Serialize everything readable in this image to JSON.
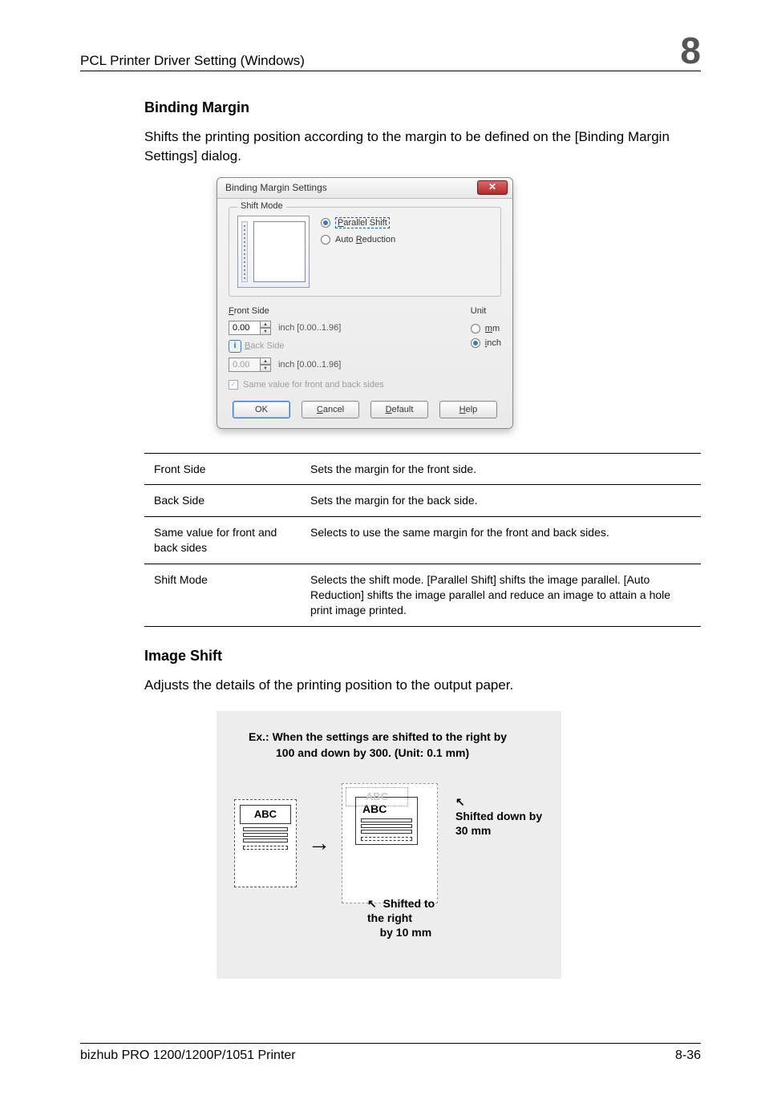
{
  "header": {
    "title": "PCL Printer Driver Setting (Windows)",
    "chapter": "8"
  },
  "section1": {
    "heading": "Binding Margin",
    "paragraph": "Shifts the printing position according to the margin to be defined on the [Binding Margin Settings] dialog."
  },
  "dialog": {
    "title": "Binding Margin Settings",
    "close_symbol": "✕",
    "shiftmode_legend": "Shift Mode",
    "radio_parallel_prefix": "P",
    "radio_parallel_rest": "arallel Shift",
    "radio_auto_pre": "Auto ",
    "radio_auto_u": "R",
    "radio_auto_post": "eduction",
    "front_u": "F",
    "front_rest": "ront Side",
    "front_value": "0.00",
    "front_range": "inch [0.00..1.96]",
    "back_u": "B",
    "back_rest": "ack Side",
    "back_value": "0.00",
    "back_range": "inch [0.00..1.96]",
    "unit_legend": "Unit",
    "unit_mm_u": "m",
    "unit_mm_rest": "m",
    "unit_inch_u": "i",
    "unit_inch_rest": "nch",
    "same_pre": "Same value for front a",
    "same_u": "n",
    "same_post": "d back sides",
    "check_mark": "✓",
    "btn_ok": "OK",
    "btn_cancel_u": "C",
    "btn_cancel_rest": "ancel",
    "btn_default_u": "D",
    "btn_default_rest": "efault",
    "btn_help_u": "H",
    "btn_help_rest": "elp",
    "info_i": "i"
  },
  "table": {
    "r1c1": "Front Side",
    "r1c2": "Sets the margin for the front side.",
    "r2c1": "Back Side",
    "r2c2": "Sets the margin for the back side.",
    "r3c1": "Same value for front and back sides",
    "r3c2": "Selects to use the same margin for the front and back sides.",
    "r4c1": "Shift Mode",
    "r4c2": "Selects the shift mode. [Parallel Shift] shifts the image parallel. [Auto Reduction] shifts the image parallel and reduce an image to attain a hole print image printed."
  },
  "section2": {
    "heading": "Image Shift",
    "paragraph": "Adjusts the details of the printing position to the output paper."
  },
  "example": {
    "line1": "Ex.:  When the settings are shifted to the right by",
    "line2": "100 and down by 300. (Unit: 0.1 mm)",
    "abc": "ABC",
    "arrow": "→",
    "diag_arrow": "↖",
    "shifted_down": "Shifted down by 30 mm",
    "cap_bottom_arrow": "↖",
    "shifted_right_l1": "Shifted to the right",
    "shifted_right_l2": "by 10 mm"
  },
  "footer": {
    "left": "bizhub PRO 1200/1200P/1051 Printer",
    "right": "8-36"
  }
}
